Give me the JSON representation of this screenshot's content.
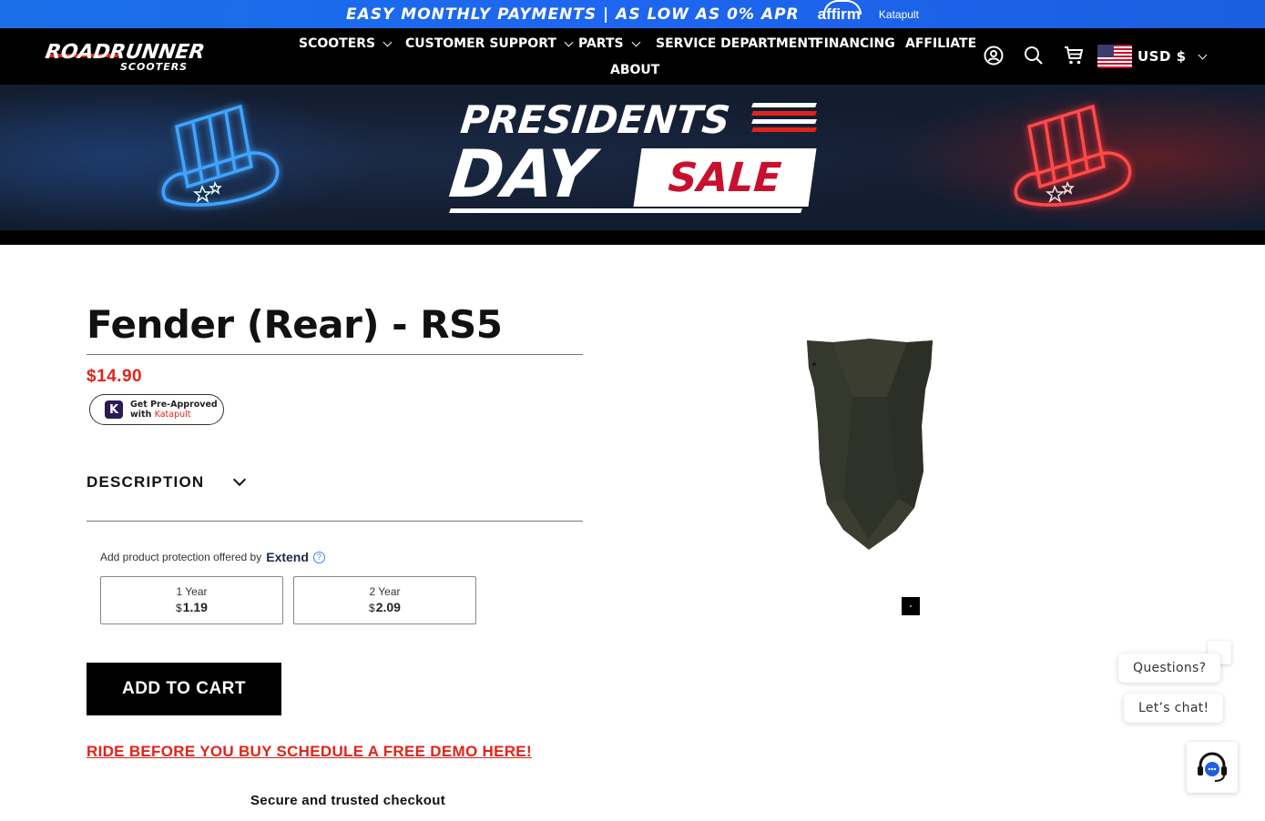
{
  "announcement": {
    "text": "EASY MONTHLY PAYMENTS | AS LOW AS 0% APR",
    "affirm": "affirm",
    "katapult": "Katapult"
  },
  "brand": {
    "name": "ROADRUNNER",
    "sub": "SCOOTERS"
  },
  "nav": {
    "items": [
      {
        "label": "SCOOTERS",
        "dropdown": true
      },
      {
        "label": "CUSTOMER SUPPORT",
        "dropdown": true
      },
      {
        "label": "PARTS",
        "dropdown": true
      },
      {
        "label": "SERVICE DEPARTMENT",
        "dropdown": false
      },
      {
        "label": "FINANCING",
        "dropdown": false
      },
      {
        "label": "AFFILIATE",
        "dropdown": false
      },
      {
        "label": "ABOUT",
        "dropdown": false
      }
    ]
  },
  "header_icons": [
    "account-icon",
    "search-icon",
    "cart-icon"
  ],
  "currency": {
    "label": "USD $"
  },
  "banner": {
    "line1": "PRESIDENTS",
    "line2": "DAY",
    "sale": "SALE"
  },
  "product": {
    "title": "Fender (Rear) - RS5",
    "price": "$14.90",
    "katapult_line1": "Get Pre-Approved",
    "katapult_with": "with",
    "katapult_brand": "Katapult",
    "description_label": "DESCRIPTION",
    "protection_text": "Add product protection offered by",
    "protection_brand": "Extend",
    "plans": [
      {
        "term": "1 Year",
        "currency": "$",
        "price": "1.19"
      },
      {
        "term": "2 Year",
        "currency": "$",
        "price": "2.09"
      }
    ],
    "add_to_cart": "ADD TO CART",
    "demo_link": "RIDE BEFORE YOU BUY SCHEDULE A FREE DEMO HERE!",
    "secure": "Secure and trusted checkout"
  },
  "chat": {
    "bubble1": "Questions?",
    "bubble2": "Let’s chat!"
  },
  "colors": {
    "announce_bg": "#1e66f0",
    "accent_red": "#e2231a",
    "header_bg": "#000000"
  }
}
